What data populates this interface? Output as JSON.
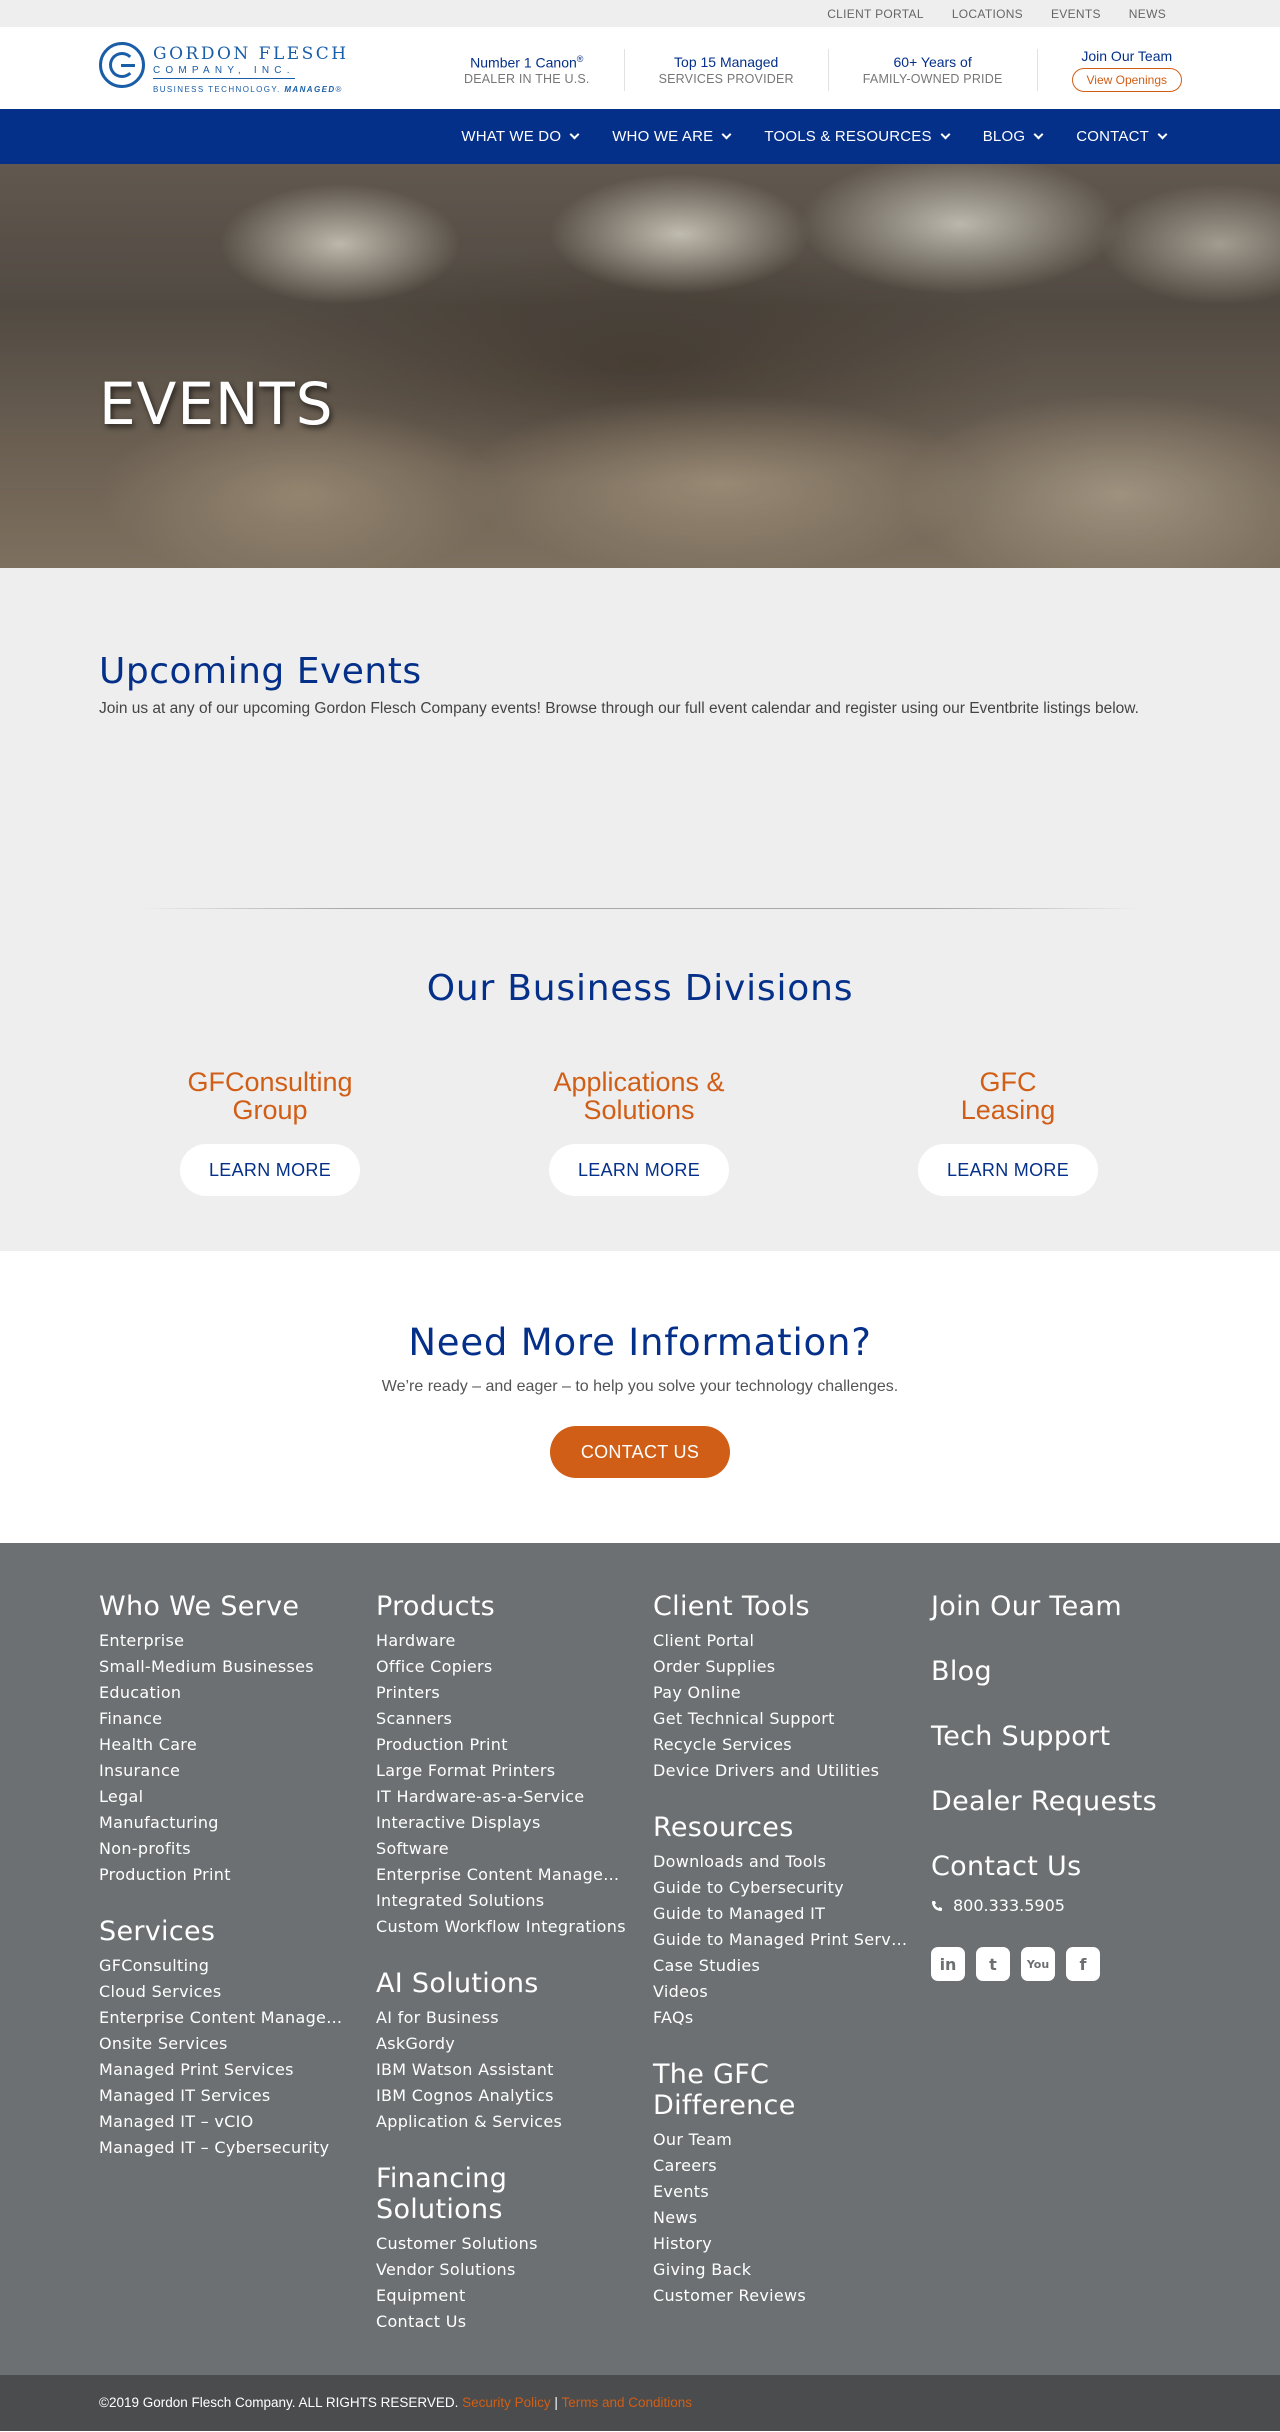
{
  "utility_nav": [
    "CLIENT PORTAL",
    "LOCATIONS",
    "EVENTS",
    "NEWS"
  ],
  "logo": {
    "name": "GORDON FLESCH",
    "company": "COMPANY, INC.",
    "tagline": "BUSINESS TECHNOLOGY.",
    "tagline_bold": "MANAGED"
  },
  "stats": [
    {
      "top": "Number 1 Canon",
      "sup": "®",
      "bottom": "DEALER IN THE U.S."
    },
    {
      "top": "Top 15 Managed",
      "bottom": "SERVICES PROVIDER"
    },
    {
      "top": "60+ Years of",
      "bottom": "FAMILY-OWNED PRIDE"
    }
  ],
  "join": {
    "title": "Join Our Team",
    "button": "View Openings"
  },
  "main_nav": [
    "WHAT WE DO",
    "WHO WE ARE",
    "TOOLS & RESOURCES",
    "BLOG",
    "CONTACT"
  ],
  "hero": {
    "title": "EVENTS"
  },
  "upcoming": {
    "title": "Upcoming Events",
    "text": "Join us at any of our upcoming Gordon Flesch Company events! Browse through our full event calendar and register using our Eventbrite listings below."
  },
  "divisions": {
    "title": "Our Business Divisions",
    "items": [
      {
        "line1": "GFConsulting",
        "line2": "Group",
        "button": "LEARN MORE"
      },
      {
        "line1": "Applications &",
        "line2": "Solutions",
        "button": "LEARN MORE"
      },
      {
        "line1": "GFC",
        "line2": "Leasing",
        "button": "LEARN MORE"
      }
    ]
  },
  "need_info": {
    "title": "Need More Information?",
    "text": "We’re ready – and eager – to help you solve your technology challenges.",
    "button": "CONTACT US"
  },
  "footer": {
    "col1": [
      {
        "title": "Who We Serve",
        "items": [
          "Enterprise",
          "Small-Medium Businesses",
          "Education",
          "Finance",
          "Health Care",
          "Insurance",
          "Legal",
          "Manufacturing",
          "Non-profits",
          "Production Print"
        ]
      },
      {
        "title": "Services",
        "items": [
          "GFConsulting",
          "Cloud Services",
          "Enterprise Content Management",
          "Onsite Services",
          "Managed Print Services",
          "Managed IT Services",
          "Managed IT – vCIO",
          "Managed IT – Cybersecurity"
        ]
      }
    ],
    "col2": [
      {
        "title": "Products",
        "items": [
          "Hardware",
          "Office Copiers",
          "Printers",
          "Scanners",
          "Production Print",
          "Large Format Printers",
          "IT Hardware-as-a-Service",
          "Interactive Displays",
          "Software",
          "Enterprise Content Management",
          "Integrated Solutions",
          "Custom Workflow Integrations"
        ]
      },
      {
        "title": "AI Solutions",
        "items": [
          "AI for Business",
          "AskGordy",
          "IBM Watson Assistant",
          "IBM Cognos Analytics",
          "Application & Services"
        ]
      },
      {
        "title": "Financing Solutions",
        "items": [
          "Customer Solutions",
          "Vendor Solutions",
          "Equipment",
          "Contact Us"
        ]
      }
    ],
    "col3": [
      {
        "title": "Client Tools",
        "items": [
          "Client Portal",
          "Order Supplies",
          "Pay Online",
          "Get Technical Support",
          "Recycle Services",
          "Device Drivers and Utilities"
        ]
      },
      {
        "title": "Resources",
        "items": [
          "Downloads and Tools",
          "Guide to Cybersecurity",
          "Guide to Managed IT",
          "Guide to Managed Print Services",
          "Case Studies",
          "Videos",
          "FAQs"
        ]
      },
      {
        "title": "The GFC Difference",
        "items": [
          "Our Team",
          "Careers",
          "Events",
          "News",
          "History",
          "Giving Back",
          "Customer Reviews"
        ]
      }
    ],
    "col4": {
      "links": [
        "Join Our Team",
        "Blog",
        "Tech Support",
        "Dealer Requests"
      ],
      "contact_title": "Contact Us",
      "phone": "800.333.5905",
      "socials": [
        {
          "icon": "linkedin-icon",
          "glyph": "in"
        },
        {
          "icon": "twitter-icon",
          "glyph": "t"
        },
        {
          "icon": "youtube-icon",
          "glyph": "You"
        },
        {
          "icon": "facebook-icon",
          "glyph": "f"
        }
      ]
    }
  },
  "copyright": {
    "text": "©2019 Gordon Flesch Company. ALL RIGHTS RESERVED.",
    "security": "Security Policy",
    "sep": "|",
    "terms": "Terms and Conditions"
  },
  "colors": {
    "brand_blue": "#05308a",
    "accent_orange": "#d15e16",
    "footer_gray": "#6c7072"
  }
}
